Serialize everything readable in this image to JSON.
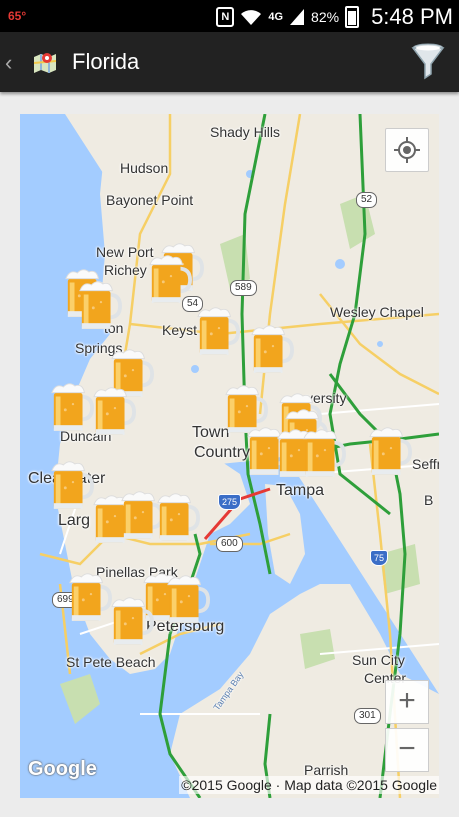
{
  "status_bar": {
    "temperature": "65°",
    "network": "4G",
    "battery": "82%",
    "time": "5:48 PM"
  },
  "app_bar": {
    "title": "Florida"
  },
  "map": {
    "labels": {
      "shady_hills": "Shady Hills",
      "hudson": "Hudson",
      "bayonet_point": "Bayonet Point",
      "new_port_richey_1": "New Port",
      "new_port_richey_2": "Richey",
      "keystone": "Keyst",
      "tarpon_1": "ton",
      "tarpon_2": "Springs",
      "wesley_chapel": "Wesley Chapel",
      "university": "versity",
      "dunedin": "Duncain",
      "town_country_1": "Town",
      "town_country_2": "Country",
      "clearwater": "Clearwater",
      "largo": "Larg",
      "tampa": "Tampa",
      "seffner": "Seffn",
      "pinellas_park": "Pinellas Park",
      "st_petersburg": "Petersburg",
      "st_pete_beach": "St Pete Beach",
      "sun_city_1": "Sun City",
      "sun_city_2": "Center",
      "parrish": "Parrish",
      "tampa_bay": "Tampa Bay",
      "b_edge": "B"
    },
    "shields": {
      "r52": "52",
      "r589": "589",
      "r54": "54",
      "i275": "275",
      "r600": "600",
      "i75": "75",
      "r699": "699",
      "r301": "301"
    },
    "attribution": "©2015 Google · Map data ©2015 Google",
    "logo": "Google"
  }
}
